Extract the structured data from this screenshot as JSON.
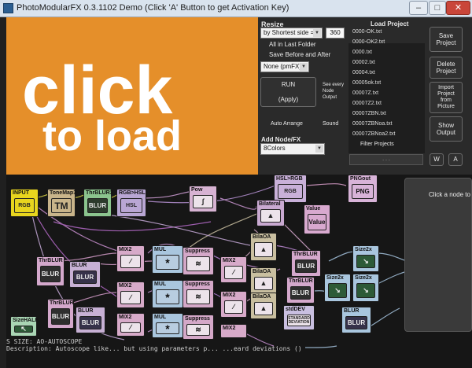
{
  "window": {
    "title": "PhotoModularFX 0.3.1102   Demo (Click 'A' Button to get Activation Key)",
    "btn_min": "–",
    "btn_max": "□",
    "btn_close": "✕"
  },
  "preview": {
    "line1": "click",
    "line2": "to load"
  },
  "resize": {
    "heading": "Resize",
    "mode": "by Shortest side =",
    "size": "360",
    "all_in_last_folder": "All in Last Folder",
    "save_before_after": "Save Before and After",
    "preset": "None (pmFX)"
  },
  "run": {
    "button": "RUN\n\n(Apply)",
    "note": "See every\nNode\nOutput",
    "auto_arrange": "Auto Arrange",
    "sound": "Sound"
  },
  "add_node": {
    "heading": "Add Node/FX",
    "value": "8Colors"
  },
  "project": {
    "heading": "Load Project",
    "files": [
      "0000-OK.txt",
      "0000-OK2.txt",
      "0000.txt",
      "00002.txt",
      "00004.txt",
      "00005ok.txt",
      "00007Z.txt",
      "00007Z2.txt",
      "00007ZBN.txt",
      "00007ZBNoa.txt",
      "00007ZBNoa2.txt"
    ],
    "filter_label": "Filter Projects",
    "filter_value": ". . ."
  },
  "actions": {
    "save": "Save\nProject",
    "delete": "Delete\nProject",
    "import": "Import\nProject\nfrom\nPicture",
    "show": "Show\nOutput",
    "w": "W",
    "a": "A"
  },
  "side_panel": {
    "hint": "Click a node to"
  },
  "nodes": [
    {
      "label": "INPUT",
      "icon": "RGB",
      "color": "#e8d51e"
    },
    {
      "label": "ToneMap3",
      "icon": "TM",
      "color": "#c9b48a"
    },
    {
      "label": "ThrBLUR3",
      "icon": "BLUR",
      "color": "#8bc48e"
    },
    {
      "label": "RGB>HSL",
      "icon": "HSL",
      "color": "#b9a6d4"
    },
    {
      "label": "Pow",
      "icon": "∫",
      "color": "#d7b3d3"
    },
    {
      "label": "HSL>RGB",
      "icon": "RGB",
      "color": "#c9b0d9"
    },
    {
      "label": "PNGout",
      "icon": "PNG",
      "color": "#d8b3d8"
    },
    {
      "label": "Bilateral",
      "icon": "▲",
      "color": "#c9a9d1"
    },
    {
      "label": "Value",
      "icon": "Value",
      "color": "#d8a9cf"
    },
    {
      "label": "ThrBLUR",
      "icon": "BLUR",
      "color": "#d4a8cc"
    },
    {
      "label": "BLUR",
      "icon": "BLUR",
      "color": "#c7b0d4"
    },
    {
      "label": "MIX2",
      "icon": "∕",
      "color": "#d7aac9"
    },
    {
      "label": "MUL",
      "icon": "*",
      "color": "#a9c6de"
    },
    {
      "label": "Suppress",
      "icon": "≋",
      "color": "#d4a8c8"
    },
    {
      "label": "BilaOA",
      "icon": "▲",
      "color": "#c9bfa0"
    },
    {
      "label": "Size2x",
      "icon": "↘",
      "color": "#a9c6de"
    },
    {
      "label": "stdDEV",
      "icon": "STANDARD DEVIATION",
      "color": "#c9bfe0"
    },
    {
      "label": "SizeHALF",
      "icon": "↖",
      "color": "#a9d6b4"
    }
  ],
  "console": {
    "line1": "S    SIZE: AO-AUTOSCOPE",
    "line2": "Description: Autoscope like... but using parameters p... ...eard deviations ()"
  },
  "colors": {
    "preview_bg": "#e58f2a",
    "panel_bg": "#2a2a2a",
    "graph_bg": "#161616"
  }
}
